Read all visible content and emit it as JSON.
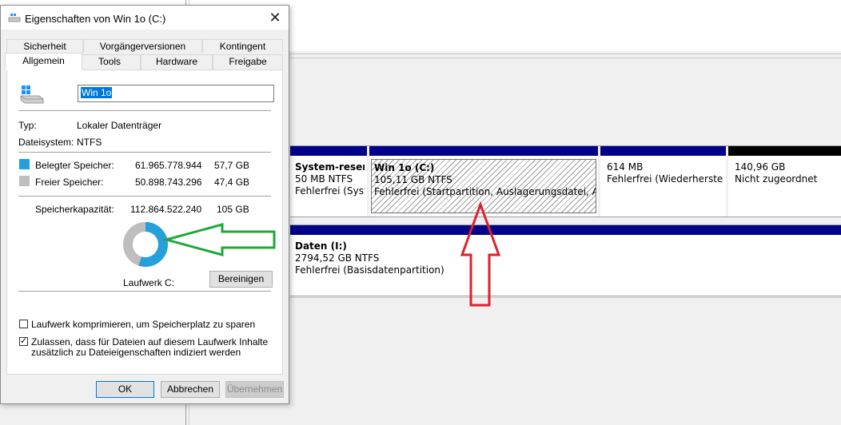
{
  "dialog": {
    "title": "Eigenschaften von Win 1o (C:)",
    "close_glyph": "✕",
    "tabs_row1": [
      "Sicherheit",
      "Vorgängerversionen",
      "Kontingent"
    ],
    "tabs_row2": [
      "Allgemein",
      "Tools",
      "Hardware",
      "Freigabe"
    ],
    "active_tab": "Allgemein",
    "drive_name": "Win 1o",
    "type_label": "Typ:",
    "type_value": "Lokaler Datenträger",
    "fs_label": "Dateisystem:",
    "fs_value": "NTFS",
    "used_label": "Belegter Speicher:",
    "used_bytes": "61.965.778.944",
    "used_gb": "57,7 GB",
    "free_label": "Freier Speicher:",
    "free_bytes": "50.898.743.296",
    "free_gb": "47,4 GB",
    "capacity_label": "Speicherkapazität:",
    "capacity_bytes": "112.864.522.240",
    "capacity_gb": "105 GB",
    "drive_label": "Laufwerk C:",
    "cleanup_button": "Bereinigen",
    "compress_label": "Laufwerk komprimieren, um Speicherplatz zu sparen",
    "compress_checked": false,
    "index_label_line1": "Zulassen, dass für Dateien auf diesem Laufwerk Inhalte",
    "index_label_line2": "zusätzlich zu Dateieigenschaften indiziert werden",
    "index_checked": true,
    "ok_button": "OK",
    "cancel_button": "Abbrechen",
    "apply_button": "Übernehmen",
    "used_fraction": 0.549,
    "colors": {
      "used": "#26a0da",
      "free": "#bebebe",
      "accent": "#0078d7"
    }
  },
  "disk_mgmt": {
    "disk0": {
      "partitions": [
        {
          "title": "System-reserv",
          "size": "50 MB NTFS",
          "status": "Fehlerfrei (Syste"
        },
        {
          "title": "Win 1o  (C:)",
          "size": "105,11 GB NTFS",
          "status": "Fehlerfrei (Startpartition, Auslagerungsdatei, Absturz"
        },
        {
          "title": "",
          "size": "614 MB",
          "status": "Fehlerfrei (Wiederherstellun"
        },
        {
          "title": "",
          "size": "140,96 GB",
          "status": "Nicht zugeordnet"
        }
      ]
    },
    "disk1": {
      "partitions": [
        {
          "title": "Daten  (I:)",
          "size": "2794,52 GB NTFS",
          "status": "Fehlerfrei (Basisdatenpartition)"
        }
      ]
    },
    "colors": {
      "primary_bar": "#00008b",
      "unallocated_bar": "#000000"
    }
  },
  "annotations": {
    "arrow_green": "#1fa83a",
    "arrow_red": "#e0202a"
  }
}
